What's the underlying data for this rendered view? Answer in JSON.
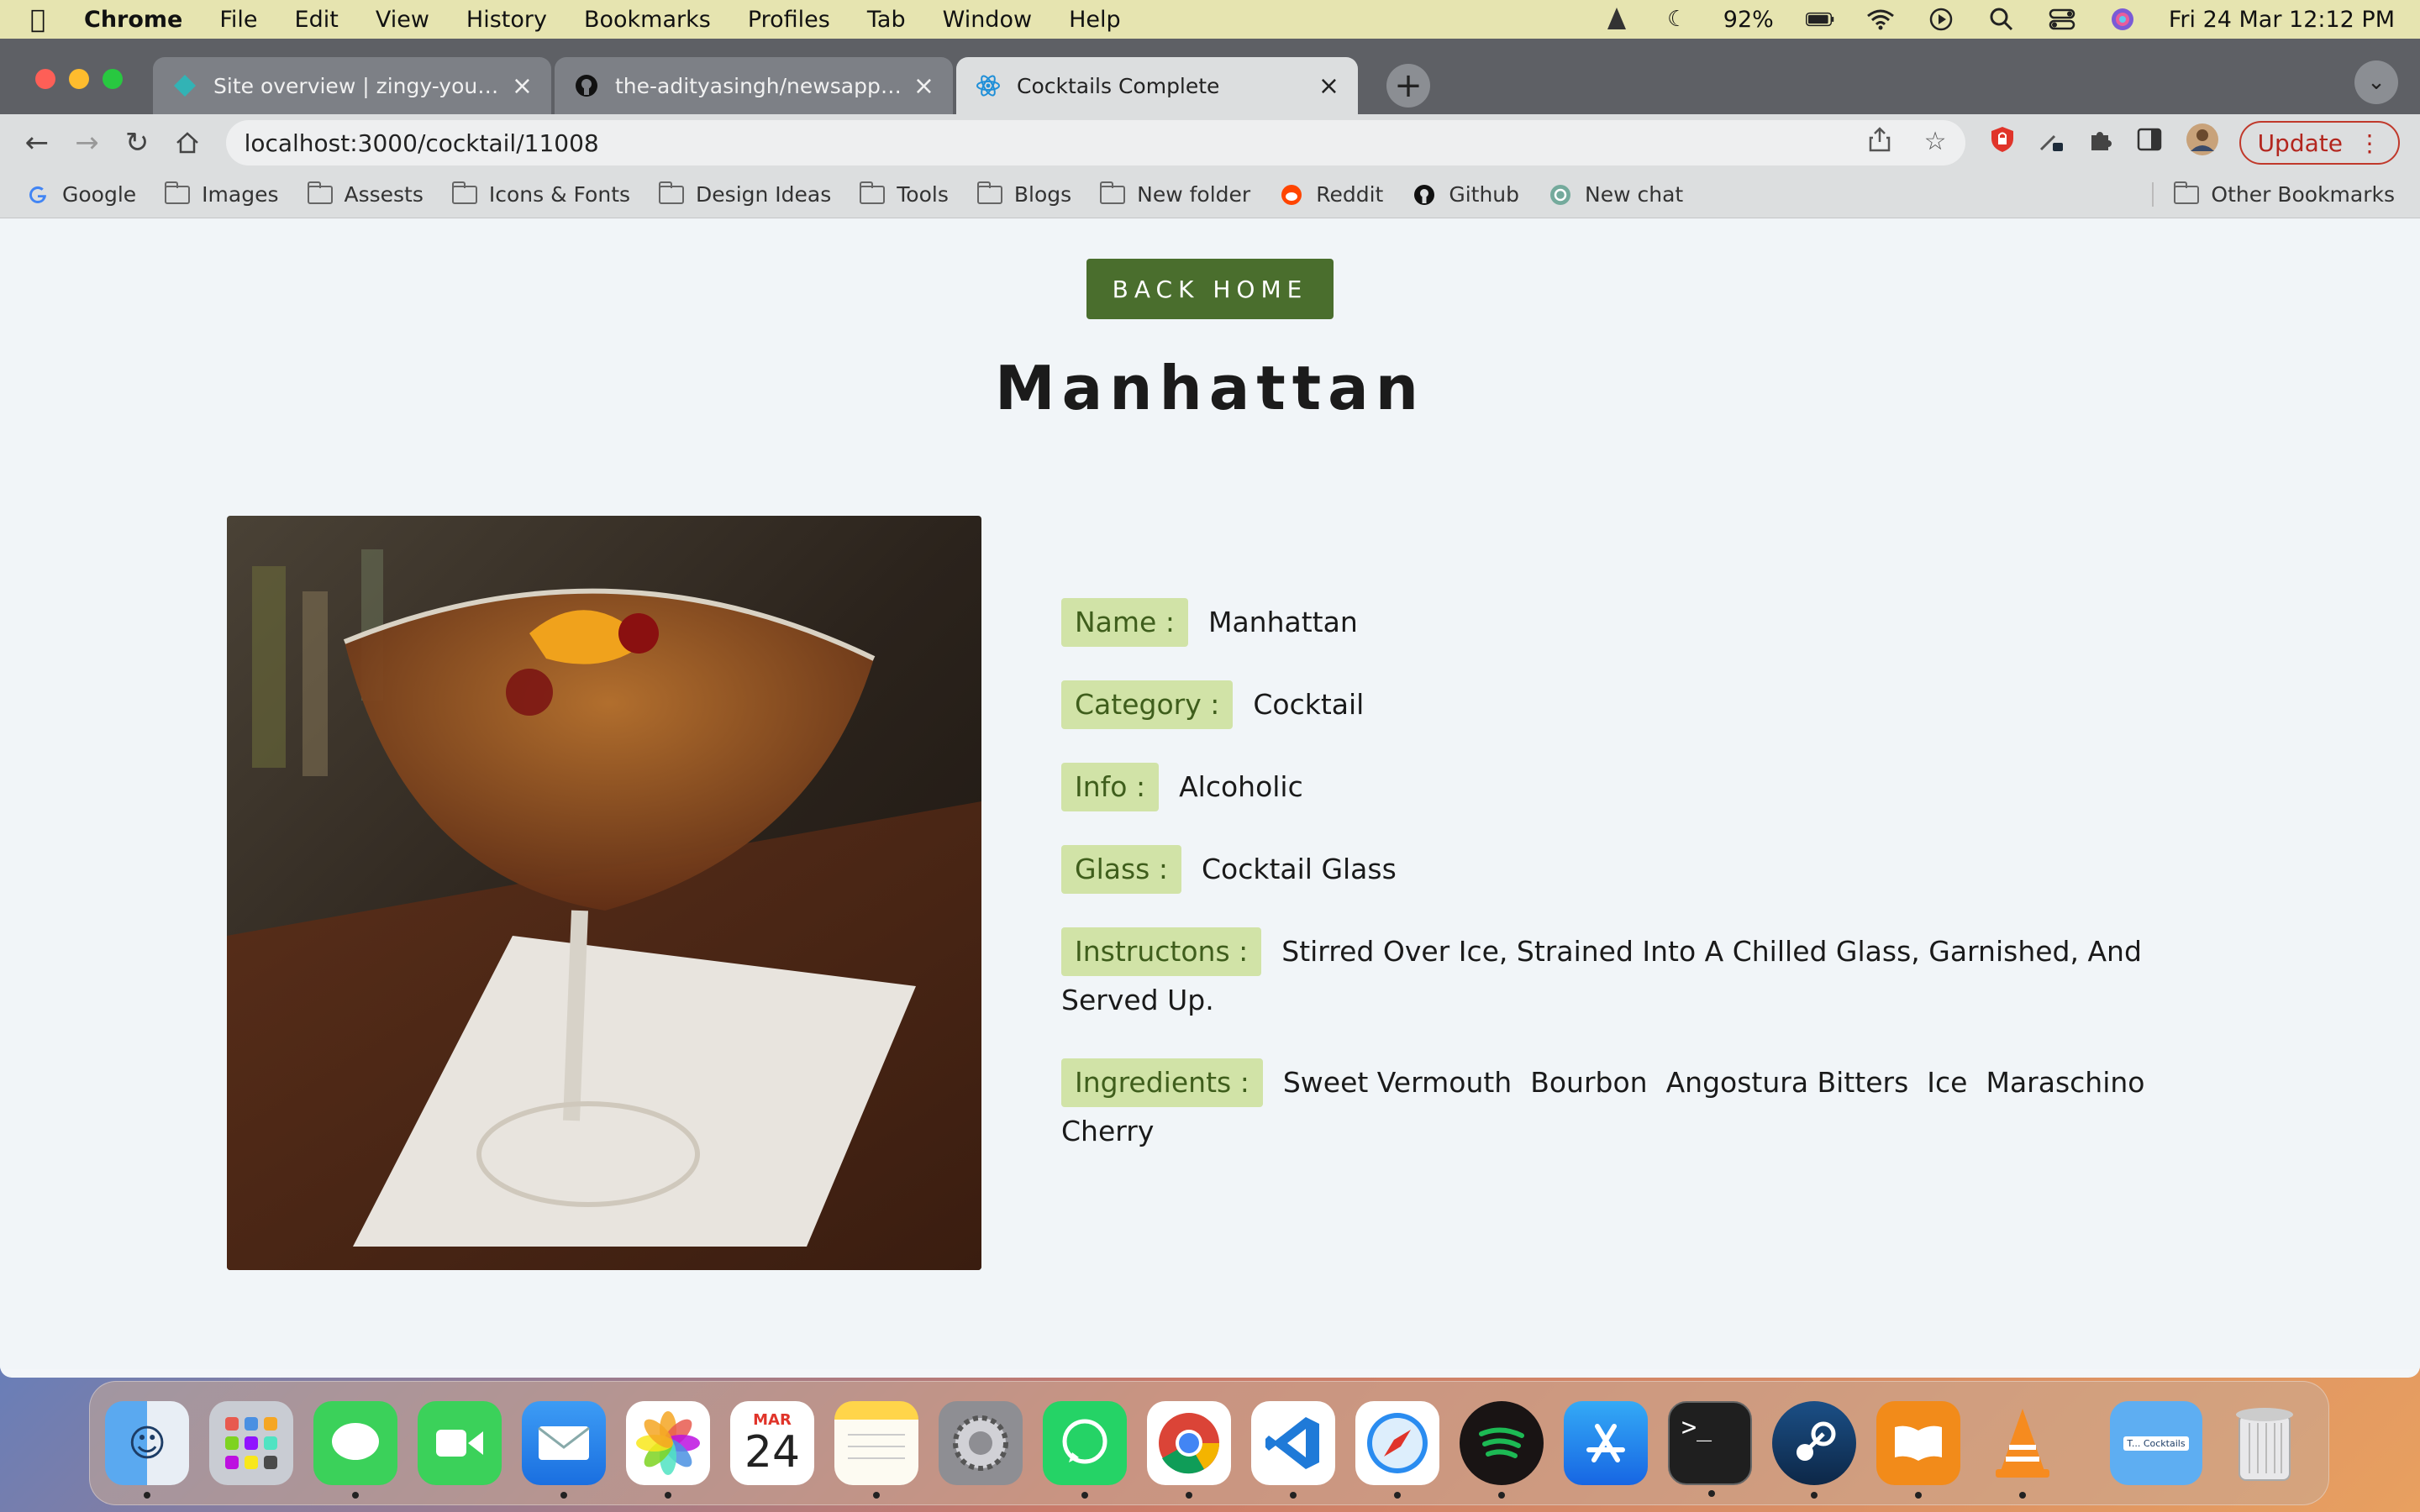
{
  "menubar": {
    "app": "Chrome",
    "items": [
      "File",
      "Edit",
      "View",
      "History",
      "Bookmarks",
      "Profiles",
      "Tab",
      "Window",
      "Help"
    ],
    "battery": "92%",
    "datetime": "Fri 24 Mar  12:12 PM"
  },
  "tabs": [
    {
      "title": "Site overview | zingy-youtiao-f",
      "icon": "netlify-icon"
    },
    {
      "title": "the-adityasingh/newsapp: A re",
      "icon": "github-icon"
    },
    {
      "title": "Cocktails Complete",
      "icon": "react-icon"
    }
  ],
  "toolbar": {
    "url": "localhost:3000/cocktail/11008",
    "update_label": "Update"
  },
  "bookmarks": {
    "items": [
      "Google",
      "Images",
      "Assests",
      "Icons & Fonts",
      "Design Ideas",
      "Tools",
      "Blogs",
      "New folder",
      "Reddit",
      "Github",
      "New chat"
    ],
    "other": "Other Bookmarks"
  },
  "page": {
    "back_label": "BACK HOME",
    "title": "Manhattan",
    "details": {
      "name_label": "Name :",
      "name": "Manhattan",
      "category_label": "Category :",
      "category": "Cocktail",
      "info_label": "Info :",
      "info": "Alcoholic",
      "glass_label": "Glass :",
      "glass": "Cocktail Glass",
      "instructions_label": "Instructons :",
      "instructions": "Stirred Over Ice, Strained Into A Chilled Glass, Garnished, And Served Up.",
      "ingredients_label": "Ingredients :",
      "ingredients": [
        "Sweet Vermouth",
        "Bourbon",
        "Angostura Bitters",
        "Ice",
        "Maraschino Cherry"
      ]
    }
  },
  "dock": {
    "calendar_month": "MAR",
    "calendar_day": "24",
    "cocktails_folder": "T... Cocktails"
  },
  "colors": {
    "accent_green": "#4a6e2d",
    "label_bg": "#d1e3a7",
    "page_bg": "#f1f5f8"
  }
}
